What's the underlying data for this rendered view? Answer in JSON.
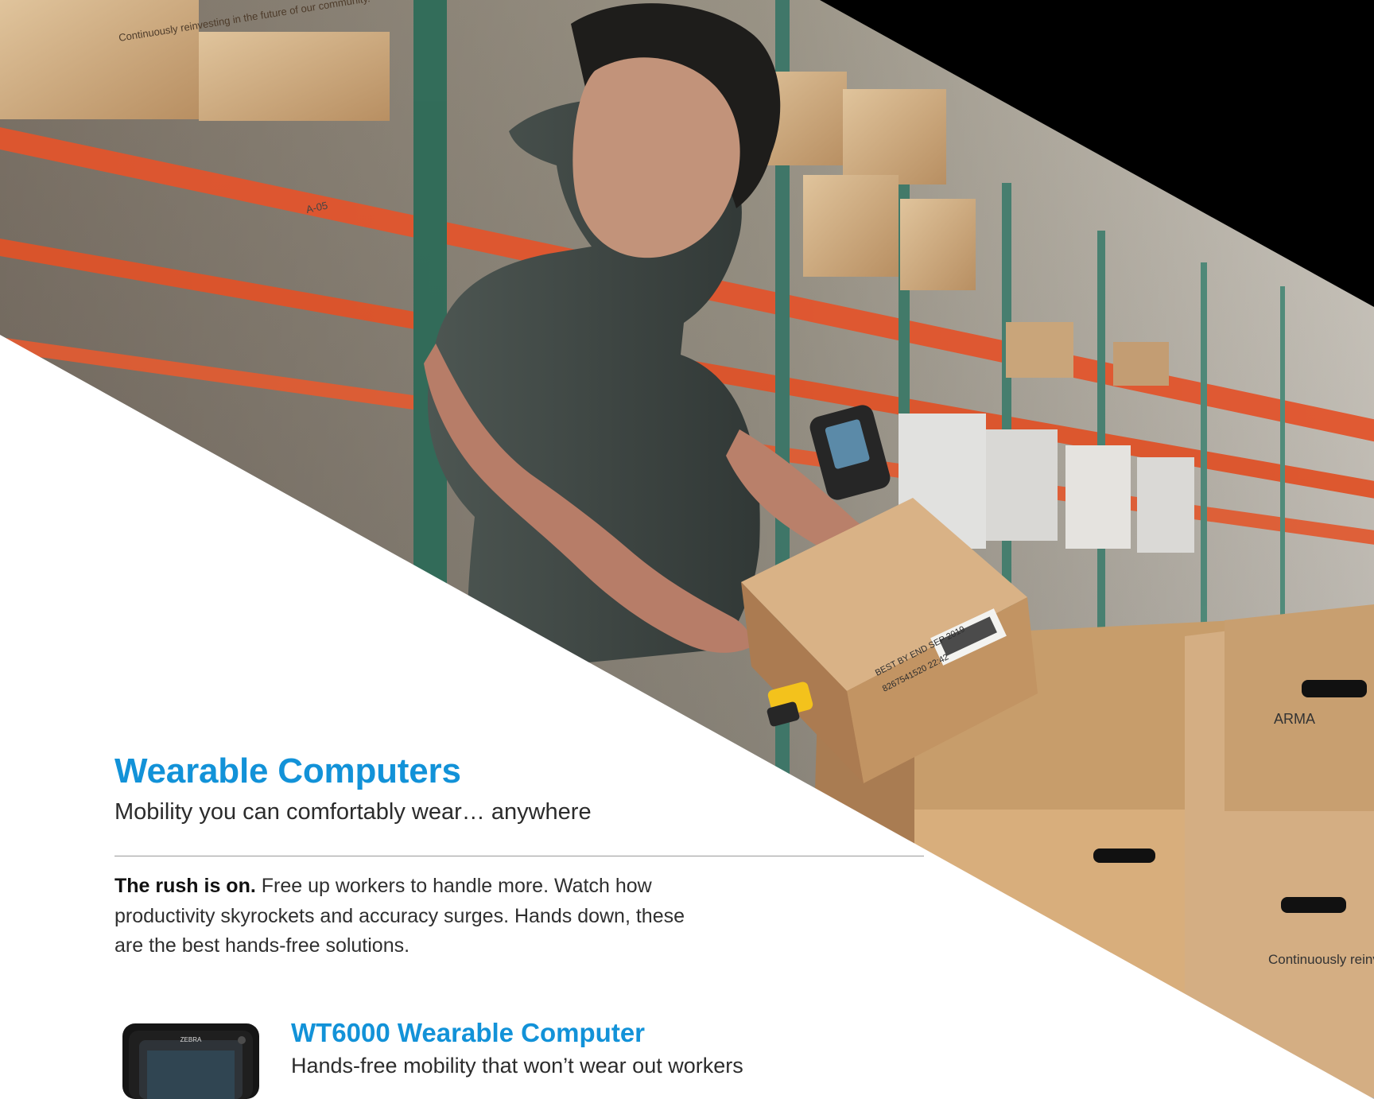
{
  "brochure": {
    "title": "Wearable Computers",
    "subtitle": "Mobility you can comfortably wear… anywhere",
    "intro_lead": "The rush is on.",
    "intro_body": " Free up workers to handle more. Watch how productivity skyrockets and accuracy surges. Hands down, these are the best hands-free solutions."
  },
  "product": {
    "title": "WT6000 Wearable Computer",
    "description": "Hands-free mobility that won’t wear out workers",
    "device_brand": "ZEBRA"
  },
  "photo_text": {
    "box_message_1": "Continuously reinvesting in the future of our community.",
    "box_brand": "ARMA",
    "box_message_2": "Continuously reinvesting in the future of our community.",
    "best_by": "BEST BY END SEP 2019",
    "lot": "8267541520 22:42",
    "rack_label": "A-05"
  },
  "colors": {
    "accent_blue": "#1292d8",
    "black_corner": "#000000"
  }
}
